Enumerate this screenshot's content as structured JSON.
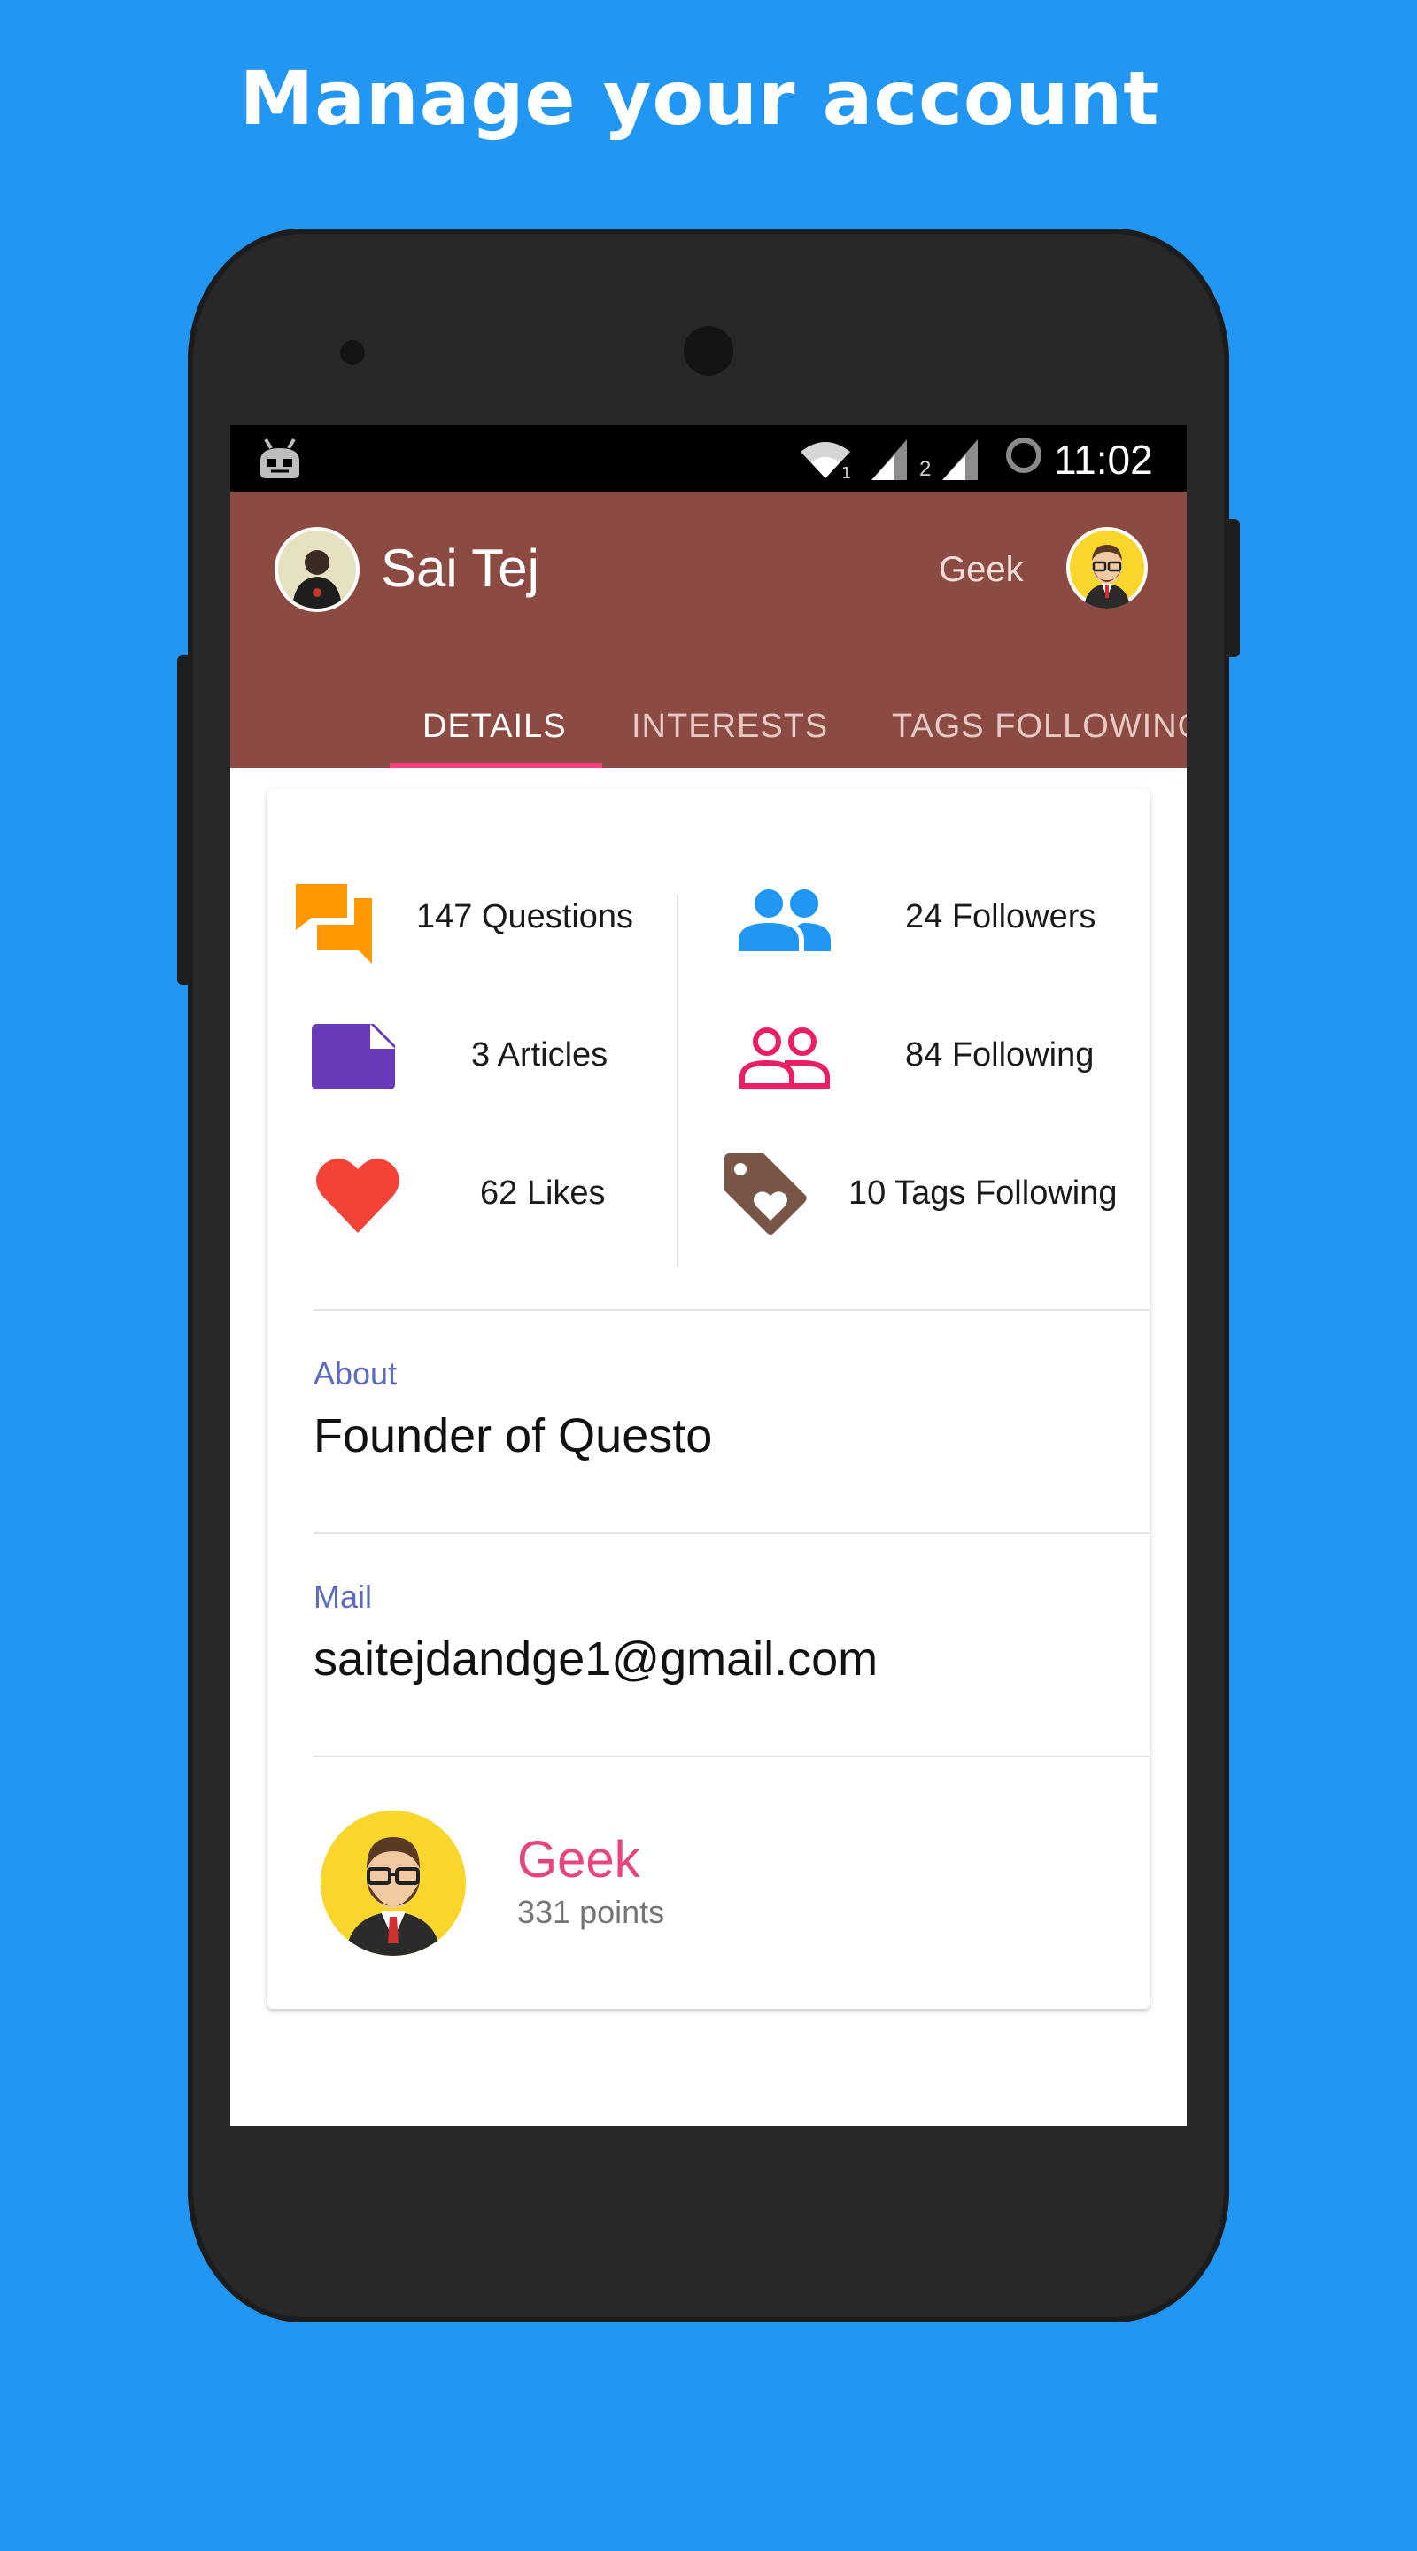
{
  "promo": {
    "title": "Manage your account"
  },
  "status_bar": {
    "time": "11:02",
    "sim2": "2",
    "icons": [
      "android-notification-icon",
      "wifi-icon",
      "signal-icon",
      "signal-icon",
      "battery-ring-icon"
    ]
  },
  "header": {
    "user_name": "Sai Tej",
    "rank": "Geek",
    "tabs": [
      {
        "label": "DETAILS",
        "active": true
      },
      {
        "label": "INTERESTS",
        "active": false
      },
      {
        "label": "TAGS FOLLOWING",
        "active": false
      }
    ]
  },
  "stats": {
    "questions": "147 Questions",
    "articles": "3 Articles",
    "likes": "62 Likes",
    "followers": "24 Followers",
    "following": "84 Following",
    "tags_following": "10 Tags Following"
  },
  "about": {
    "label": "About",
    "value": "Founder of Questo"
  },
  "mail": {
    "label": "Mail",
    "value": "saitejdandge1@gmail.com"
  },
  "badge": {
    "title": "Geek",
    "points": "331 points"
  },
  "colors": {
    "background": "#2196F3",
    "app_bar": "#8B4A42",
    "tab_indicator": "#FF4081",
    "questions_icon": "#FF9800",
    "articles_icon": "#673AB7",
    "likes_icon": "#F44336",
    "followers_icon": "#2196F3",
    "following_icon": "#E91E63",
    "tags_icon": "#795548",
    "field_label": "#5C6BC0",
    "badge_title": "#E8457F"
  }
}
